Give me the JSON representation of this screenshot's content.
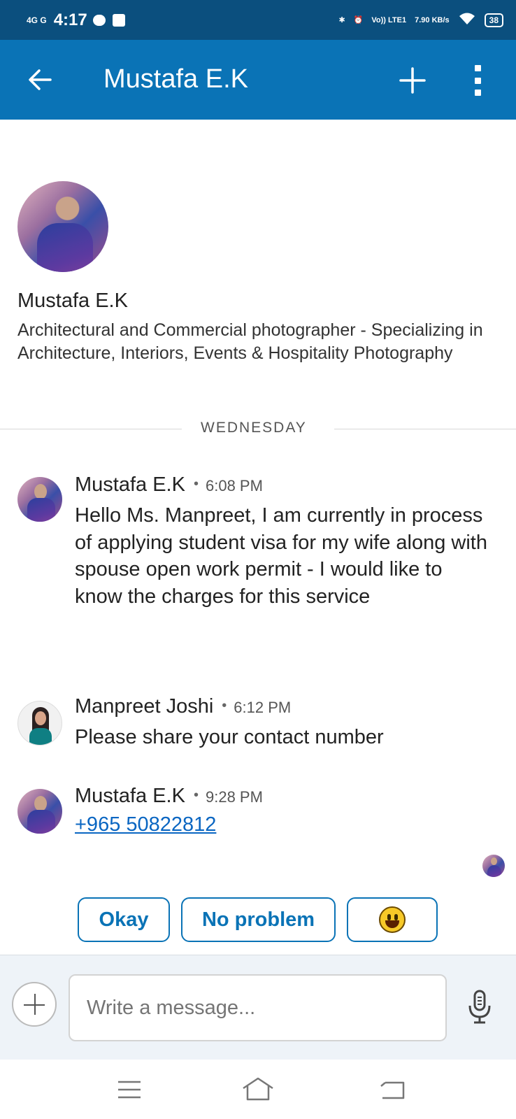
{
  "status_bar": {
    "network_label": "4G G",
    "time": "4:17",
    "volte_label": "Vo)) LTE1",
    "speed": "7.90 KB/s",
    "battery": "38"
  },
  "app_bar": {
    "title": "Mustafa E.K"
  },
  "profile": {
    "name": "Mustafa E.K",
    "headline": "Architectural and Commercial photographer - Specializing in Architecture, Interiors, Events & Hospitality Photography"
  },
  "divider": {
    "day": "WEDNESDAY"
  },
  "messages": [
    {
      "sender": "Mustafa E.K",
      "separator": "•",
      "time": "6:08 PM",
      "text": "Hello Ms. Manpreet, I am currently in process of applying student visa for my wife along with spouse open work permit - I would like to know the charges for this service"
    },
    {
      "sender": "Manpreet Joshi",
      "separator": "•",
      "time": "6:12 PM",
      "text": "Please share your contact number"
    },
    {
      "sender": "Mustafa E.K",
      "separator": "•",
      "time": "9:28 PM",
      "text": "+965 50822812"
    }
  ],
  "quick_replies": [
    "Okay",
    "No problem"
  ],
  "composer": {
    "placeholder": "Write a message..."
  },
  "icons": {
    "back": "arrow-left-icon",
    "new": "plus-icon",
    "more": "more-vertical-icon",
    "emoji": "grinning-face-icon",
    "mic": "microphone-icon",
    "nav_menu": "menu-icon",
    "nav_home": "home-icon",
    "nav_back": "back-nav-icon"
  },
  "colors": {
    "status_bar": "#0b4f7e",
    "app_bar": "#0a73b6",
    "link": "#0a66c2",
    "composer_bg": "#eef3f8"
  }
}
